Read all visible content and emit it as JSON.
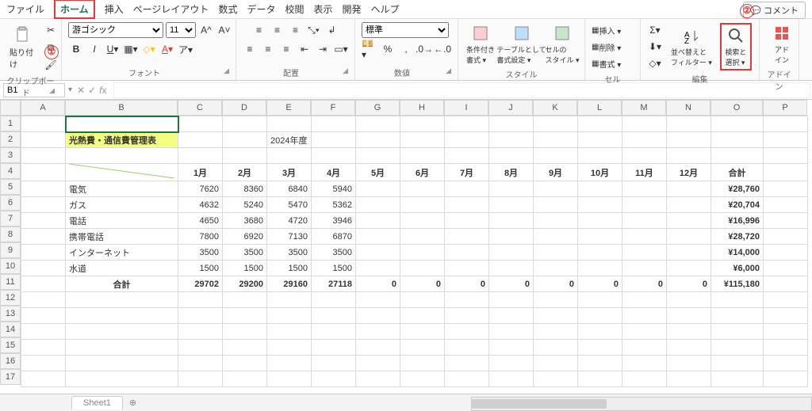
{
  "menu": {
    "file": "ファイル",
    "home": "ホーム",
    "insert": "挿入",
    "pagelayout": "ページレイアウト",
    "formulas": "数式",
    "data": "データ",
    "review": "校閲",
    "view": "表示",
    "developer": "開発",
    "help": "ヘルプ",
    "comment": "コメント"
  },
  "annot": {
    "one": "①",
    "two": "②"
  },
  "ribbon": {
    "clipboard": {
      "paste": "貼り付け",
      "label": "クリップボード"
    },
    "font": {
      "name": "游ゴシック",
      "size": "11",
      "label": "フォント"
    },
    "align": {
      "label": "配置",
      "wrap": "",
      "merge": ""
    },
    "number": {
      "format": "標準",
      "label": "数値"
    },
    "style": {
      "cond": "条件付き\n書式 ▾",
      "table": "テーブルとして\n書式設定 ▾",
      "cell": "セルの\nスタイル ▾",
      "label": "スタイル"
    },
    "cells": {
      "insert": "挿入 ▾",
      "delete": "削除 ▾",
      "format": "書式 ▾",
      "label": "セル"
    },
    "editing": {
      "sort": "並べ替えと\nフィルター ▾",
      "find": "検索と\n選択 ▾",
      "label": "編集"
    },
    "addin": {
      "btn": "アド\nイン",
      "label": "アドイン"
    }
  },
  "namebox": "B1",
  "cols": [
    "A",
    "B",
    "C",
    "D",
    "E",
    "F",
    "G",
    "H",
    "I",
    "J",
    "K",
    "L",
    "M",
    "N",
    "O",
    "P"
  ],
  "rows": [
    "1",
    "2",
    "3",
    "4",
    "5",
    "6",
    "7",
    "8",
    "9",
    "10",
    "11",
    "12",
    "13",
    "14",
    "15",
    "16",
    "17"
  ],
  "sheet": {
    "title": "光熱費・通信費管理表",
    "year": "2024年度",
    "months": [
      "1月",
      "2月",
      "3月",
      "4月",
      "5月",
      "6月",
      "7月",
      "8月",
      "9月",
      "10月",
      "11月",
      "12月",
      "合計"
    ],
    "rowsData": [
      {
        "label": "電気",
        "v": [
          "7620",
          "8360",
          "6840",
          "5940",
          "",
          "",
          "",
          "",
          "",
          "",
          "",
          "",
          ""
        ],
        "total": "¥28,760"
      },
      {
        "label": "ガス",
        "v": [
          "4632",
          "5240",
          "5470",
          "5362",
          "",
          "",
          "",
          "",
          "",
          "",
          "",
          "",
          ""
        ],
        "total": "¥20,704"
      },
      {
        "label": "電話",
        "v": [
          "4650",
          "3680",
          "4720",
          "3946",
          "",
          "",
          "",
          "",
          "",
          "",
          "",
          "",
          ""
        ],
        "total": "¥16,996"
      },
      {
        "label": "携帯電話",
        "v": [
          "7800",
          "6920",
          "7130",
          "6870",
          "",
          "",
          "",
          "",
          "",
          "",
          "",
          "",
          ""
        ],
        "total": "¥28,720"
      },
      {
        "label": "インターネット",
        "v": [
          "3500",
          "3500",
          "3500",
          "3500",
          "",
          "",
          "",
          "",
          "",
          "",
          "",
          "",
          ""
        ],
        "total": "¥14,000"
      },
      {
        "label": "水道",
        "v": [
          "1500",
          "1500",
          "1500",
          "1500",
          "",
          "",
          "",
          "",
          "",
          "",
          "",
          "",
          ""
        ],
        "total": "¥6,000"
      }
    ],
    "totalsLabel": "合計",
    "totals": [
      "29702",
      "29200",
      "29160",
      "27118",
      "0",
      "0",
      "0",
      "0",
      "0",
      "0",
      "0",
      "0"
    ],
    "grand": "¥115,180"
  },
  "tab": "Sheet1",
  "chart_data": {
    "type": "table",
    "categories": [
      "1月",
      "2月",
      "3月",
      "4月",
      "5月",
      "6月",
      "7月",
      "8月",
      "9月",
      "10月",
      "11月",
      "12月"
    ],
    "series": [
      {
        "name": "電気",
        "values": [
          7620,
          8360,
          6840,
          5940,
          null,
          null,
          null,
          null,
          null,
          null,
          null,
          null
        ]
      },
      {
        "name": "ガス",
        "values": [
          4632,
          5240,
          5470,
          5362,
          null,
          null,
          null,
          null,
          null,
          null,
          null,
          null
        ]
      },
      {
        "name": "電話",
        "values": [
          4650,
          3680,
          4720,
          3946,
          null,
          null,
          null,
          null,
          null,
          null,
          null,
          null
        ]
      },
      {
        "name": "携帯電話",
        "values": [
          7800,
          6920,
          7130,
          6870,
          null,
          null,
          null,
          null,
          null,
          null,
          null,
          null
        ]
      },
      {
        "name": "インターネット",
        "values": [
          3500,
          3500,
          3500,
          3500,
          null,
          null,
          null,
          null,
          null,
          null,
          null,
          null
        ]
      },
      {
        "name": "水道",
        "values": [
          1500,
          1500,
          1500,
          1500,
          null,
          null,
          null,
          null,
          null,
          null,
          null,
          null
        ]
      }
    ],
    "column_totals": [
      29702,
      29200,
      29160,
      27118,
      0,
      0,
      0,
      0,
      0,
      0,
      0,
      0
    ],
    "row_totals": [
      28760,
      20704,
      16996,
      28720,
      14000,
      6000
    ],
    "grand_total": 115180,
    "title": "光熱費・通信費管理表 2024年度"
  }
}
